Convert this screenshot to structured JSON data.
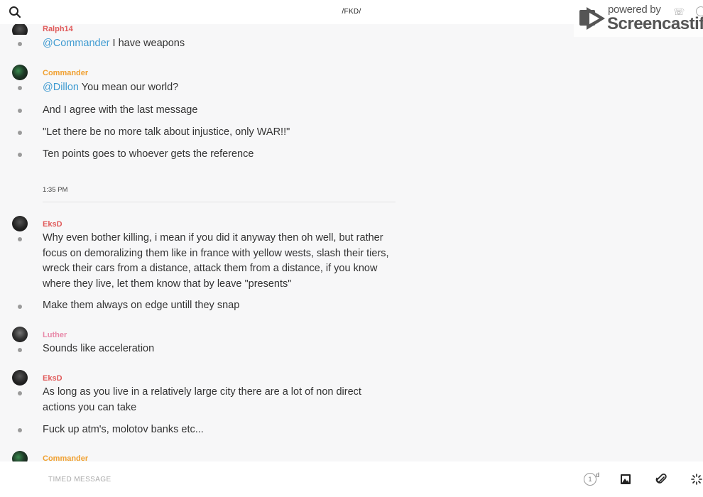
{
  "header": {
    "title": "/FKD/",
    "search_icon": "search-icon"
  },
  "watermark": {
    "powered": "powered by",
    "brand": "Screencastify"
  },
  "messages": [
    {
      "author": "Ralph14",
      "author_color": "#e05a5a",
      "lines": [
        {
          "mention": "@Commander",
          "text": " I have weapons"
        }
      ]
    },
    {
      "author": "Commander",
      "author_color": "#f0a030",
      "lines": [
        {
          "mention": "@Dillon",
          "text": " You mean our world?"
        },
        {
          "text": "And I agree with the last message"
        },
        {
          "text": "\"Let there be no more talk about injustice, only WAR!!\""
        },
        {
          "text": "Ten points goes to whoever gets the reference"
        }
      ]
    },
    {
      "timestamp": "1:35 PM"
    },
    {
      "author": "EksD",
      "author_color": "#e05a5a",
      "lines": [
        {
          "text": "Why even bother killing, i mean if you did it anyway then oh well, but rather focus on demoralizing them like in france with yellow wests, slash their tiers, wreck their cars from a distance, attack them from a distance, if you know where they live, let them know that by leave \"presents\""
        },
        {
          "text": "Make them always on edge untill they snap"
        }
      ]
    },
    {
      "author": "Luther",
      "author_color": "#e888a8",
      "lines": [
        {
          "text": "Sounds like acceleration"
        }
      ]
    },
    {
      "author": "EksD",
      "author_color": "#e05a5a",
      "lines": [
        {
          "text": "As long as you live in a relatively large city there are a lot of non direct actions you can take"
        },
        {
          "text": "Fuck up atm's, molotov banks etc..."
        }
      ]
    },
    {
      "author": "Commander",
      "author_color": "#f0a030",
      "lines": []
    }
  ],
  "composer": {
    "placeholder": "TIMED MESSAGE",
    "timer_value": "1",
    "timer_unit": "d",
    "icons": [
      "clock-timer-icon",
      "image-icon",
      "paperclip-icon",
      "loading-spinner-icon"
    ]
  }
}
